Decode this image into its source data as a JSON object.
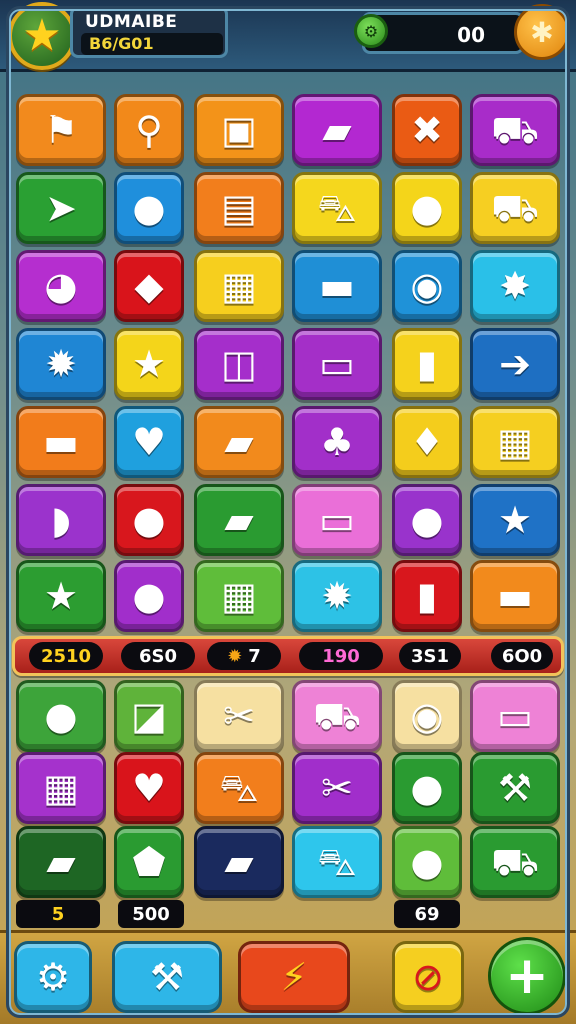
{
  "header": {
    "title": "UDMAIBE",
    "subtitle": "B6/G01",
    "coins": "00",
    "star_icon": "star-icon",
    "gem_icon": "gem-icon",
    "puzzle_icon": "puzzle-icon"
  },
  "board": {
    "rows_top": [
      [
        {
          "icon": "flag",
          "glyph": "⚑",
          "color": "#f28a1d"
        },
        {
          "icon": "magnifier",
          "glyph": "⚲",
          "color": "#f2891a"
        },
        {
          "icon": "cat-frame",
          "glyph": "▣",
          "color": "#f39319"
        },
        {
          "icon": "book",
          "glyph": "▰",
          "color": "#b328d1"
        },
        {
          "icon": "x-shape",
          "glyph": "✖",
          "color": "#ea5b14"
        },
        {
          "icon": "truck",
          "glyph": "⛟",
          "color": "#a82cc9"
        }
      ],
      [
        {
          "icon": "paper-plane",
          "glyph": "➤",
          "color": "#2aa033"
        },
        {
          "icon": "apple",
          "glyph": "●",
          "color": "#1f8fdc"
        },
        {
          "icon": "basket",
          "glyph": "▤",
          "color": "#f27e1c"
        },
        {
          "icon": "toy-car",
          "glyph": "⛍",
          "color": "#f5d71d"
        },
        {
          "icon": "red-apple",
          "glyph": "●",
          "color": "#f4d51a"
        },
        {
          "icon": "red-car",
          "glyph": "⛟",
          "color": "#f6cf22"
        }
      ],
      [
        {
          "icon": "gamepad",
          "glyph": "◕",
          "color": "#b52ecf"
        },
        {
          "icon": "gift-box",
          "glyph": "◆",
          "color": "#d9141b"
        },
        {
          "icon": "printer",
          "glyph": "▦",
          "color": "#f6cf1e"
        },
        {
          "icon": "package",
          "glyph": "▬",
          "color": "#1f8fd6"
        },
        {
          "icon": "green-bulb",
          "glyph": "◉",
          "color": "#1f92d8"
        },
        {
          "icon": "sun",
          "glyph": "✸",
          "color": "#2ac0e8"
        }
      ],
      [
        {
          "icon": "gear",
          "glyph": "✹",
          "color": "#1f86d4"
        },
        {
          "icon": "pink-star",
          "glyph": "★",
          "color": "#f4d51a"
        },
        {
          "icon": "box-open",
          "glyph": "◫",
          "color": "#a52ecb"
        },
        {
          "icon": "van",
          "glyph": "▭",
          "color": "#a42fc8"
        },
        {
          "icon": "bottle",
          "glyph": "▮",
          "color": "#f5d21c"
        },
        {
          "icon": "red-truck",
          "glyph": "➔",
          "color": "#1e6fc2"
        }
      ],
      [
        {
          "icon": "blue-box",
          "glyph": "▬",
          "color": "#f27c1b"
        },
        {
          "icon": "heart",
          "glyph": "♥",
          "color": "#1fa0de"
        },
        {
          "icon": "ticket",
          "glyph": "▰",
          "color": "#f28a1c"
        },
        {
          "icon": "plant-pot",
          "glyph": "♣",
          "color": "#a22fc9"
        },
        {
          "icon": "leaf",
          "glyph": "♦",
          "color": "#f4cd1c"
        },
        {
          "icon": "calendar",
          "glyph": "▦",
          "color": "#f5cf20"
        }
      ],
      [
        {
          "icon": "lemon",
          "glyph": "◗",
          "color": "#9b33cc"
        },
        {
          "icon": "orange",
          "glyph": "●",
          "color": "#d8171d"
        },
        {
          "icon": "baguette",
          "glyph": "▰",
          "color": "#2a9b31"
        },
        {
          "icon": "skateboard",
          "glyph": "▭",
          "color": "#ea6fd8"
        },
        {
          "icon": "green-fruit",
          "glyph": "●",
          "color": "#9933cc"
        },
        {
          "icon": "yellow-star",
          "glyph": "★",
          "color": "#1f72c6"
        }
      ],
      [
        {
          "icon": "gold-star",
          "glyph": "★",
          "color": "#2c9d31"
        },
        {
          "icon": "green-apple",
          "glyph": "●",
          "color": "#a12ecb"
        },
        {
          "icon": "cash-register",
          "glyph": "▦",
          "color": "#5fbd3a"
        },
        {
          "icon": "cog",
          "glyph": "✹",
          "color": "#2dc2e6"
        },
        {
          "icon": "trash-bin",
          "glyph": "▮",
          "color": "#d8171d"
        },
        {
          "icon": "device",
          "glyph": "▬",
          "color": "#f28a1c"
        }
      ]
    ],
    "rows_bottom": [
      [
        {
          "icon": "tomato",
          "glyph": "●",
          "color": "#3da43a"
        },
        {
          "icon": "blue-card",
          "glyph": "◪",
          "color": "#5fb33a"
        },
        {
          "icon": "tools",
          "glyph": "✂",
          "color": "#f6e0a1"
        },
        {
          "icon": "lawnmower",
          "glyph": "⛟",
          "color": "#ee82d6"
        },
        {
          "icon": "red-ball",
          "glyph": "◉",
          "color": "#f6e0a1"
        },
        {
          "icon": "paper-strip",
          "glyph": "▭",
          "color": "#ee82d6"
        }
      ],
      [
        {
          "icon": "crate",
          "glyph": "▦",
          "color": "#a532cc"
        },
        {
          "icon": "location-pin",
          "glyph": "♥",
          "color": "#d9141b"
        },
        {
          "icon": "blue-car",
          "glyph": "⛍",
          "color": "#f27e1c"
        },
        {
          "icon": "scissors",
          "glyph": "✂",
          "color": "#a12ecb"
        },
        {
          "icon": "blue-ball",
          "glyph": "●",
          "color": "#2a9b31"
        },
        {
          "icon": "drill",
          "glyph": "⚒",
          "color": "#2a9b31"
        }
      ],
      [
        {
          "icon": "cheese",
          "glyph": "▰",
          "color": "#1e6624"
        },
        {
          "icon": "gem",
          "glyph": "⬟",
          "color": "#2a9b31"
        },
        {
          "icon": "bread-roll",
          "glyph": "▰",
          "color": "#1a2a5e"
        },
        {
          "icon": "red-car-2",
          "glyph": "⛍",
          "color": "#2ec6ec"
        },
        {
          "icon": "silver-ball",
          "glyph": "●",
          "color": "#5fbd3a"
        },
        {
          "icon": "taxi",
          "glyph": "⛟",
          "color": "#2a9b31"
        }
      ]
    ]
  },
  "score_bar": [
    {
      "label": "2510",
      "style": "yellow"
    },
    {
      "label": "6S0",
      "style": "white"
    },
    {
      "label": "7",
      "style": "white",
      "icon": "sun-icon"
    },
    {
      "label": "190",
      "style": "magenta"
    },
    {
      "label": "3S1",
      "style": "white"
    },
    {
      "label": "6O0",
      "style": "white"
    }
  ],
  "counters": [
    {
      "label": "5",
      "style": "yellow"
    },
    {
      "label": "500",
      "style": "white"
    },
    {
      "label": "69",
      "style": "white"
    }
  ],
  "toolbar": {
    "settings_icon": "gear-icon",
    "hammer_icon": "hammer-icon",
    "lightning_icon": "lightning-icon",
    "cancel_icon": "cancel-icon",
    "add_label": "+"
  }
}
